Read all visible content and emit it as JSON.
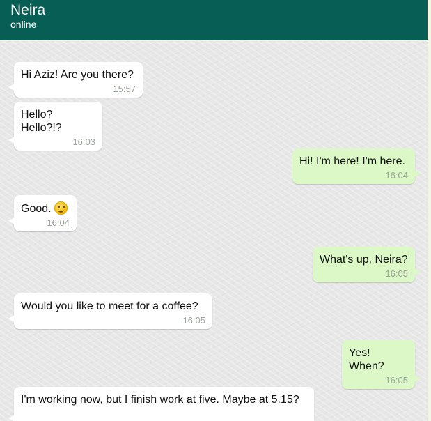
{
  "contact": {
    "name": "Neira",
    "status": "online"
  },
  "messages": [
    {
      "text": "Hi Aziz! Are you there?",
      "time": "15:57"
    },
    {
      "text": "Hello? Hello?!?",
      "time": "16:03"
    },
    {
      "text": "Hi! I'm here! I'm here.",
      "time": "16:04"
    },
    {
      "text": "Good.",
      "time": "16:04",
      "icon": "smile-emoji-icon"
    },
    {
      "text": "What's up, Neira?",
      "time": "16:05"
    },
    {
      "text": "Would you like to meet for a coffee?",
      "time": "16:05"
    },
    {
      "text": "Yes! When?",
      "time": "16:05"
    },
    {
      "text": "I'm working now, but I finish work at five. Maybe at 5.15?",
      "time": ""
    }
  ],
  "colors": {
    "header": "#075e54",
    "incoming_bubble": "#ffffff",
    "outgoing_bubble": "#dcf8c6",
    "chat_background": "#e8e8e8"
  }
}
